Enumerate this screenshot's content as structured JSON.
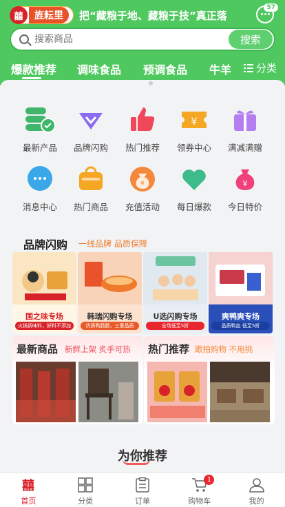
{
  "header": {
    "logo_char": "囍",
    "logo_text": "旌耘里",
    "marquee": "把“藏粮于地、藏粮于技”真正落",
    "message_badge": "57",
    "search_placeholder": "搜索商品",
    "search_button": "搜索",
    "tabs": [
      "爆款推荐",
      "调味食品",
      "预调食品",
      "牛羊"
    ],
    "category_button": "分类"
  },
  "quick_links": [
    {
      "label": "最新产品",
      "icon": "cash-stack-icon",
      "color": "#3fb66b"
    },
    {
      "label": "品牌闪购",
      "icon": "diamond-icon",
      "color": "#8a6cf0"
    },
    {
      "label": "热门推荐",
      "icon": "thumbs-up-icon",
      "color": "#f0485a"
    },
    {
      "label": "领券中心",
      "icon": "coupon-icon",
      "color": "#f5a623"
    },
    {
      "label": "满减满赠",
      "icon": "gift-box-icon",
      "color": "#b57ef0"
    },
    {
      "label": "消息中心",
      "icon": "chat-bubble-icon",
      "color": "#3aa8e8"
    },
    {
      "label": "热门商品",
      "icon": "shopping-bag-icon",
      "color": "#f5a623"
    },
    {
      "label": "充值活动",
      "icon": "money-bag-icon",
      "color": "#f5893b"
    },
    {
      "label": "每日爆款",
      "icon": "heart-icon",
      "color": "#3dbb8a"
    },
    {
      "label": "今日特价",
      "icon": "moneybag-pink-icon",
      "color": "#f0407a"
    }
  ],
  "brand_flash": {
    "title": "品牌闪购",
    "subtitle": "一线品牌 品质保障",
    "cards": [
      {
        "name": "国之味专场",
        "sub": "火锅调味料，好料不添加",
        "name_color": "#d8222a",
        "sub_color": "#d8222a"
      },
      {
        "name": "韩瑞闪购专场",
        "sub": "优质鸭肠肠，三重品质",
        "name_color": "#333333",
        "sub_color": "#e85a2a"
      },
      {
        "name": "U选闪购专场",
        "sub": "全场低至5折",
        "name_color": "#333333",
        "sub_color": "#e8262e"
      },
      {
        "name": "爽鸭爽专场",
        "sub": "品质鸭血 低至5折",
        "name_color": "#ffffff",
        "sub_color": "#1b3fa0"
      }
    ]
  },
  "promos": [
    {
      "title": "最新商品",
      "subtitle": "新鲜上架 炙手可热",
      "subtitle_color": "#f0485a"
    },
    {
      "title": "热门推荐",
      "subtitle": "跟拍购物 不用挑",
      "subtitle_color": "#f5893b"
    }
  ],
  "recommend_title": "为你推荐",
  "tabbar": {
    "items": [
      {
        "label": "首页",
        "icon": "home-logo-icon"
      },
      {
        "label": "分类",
        "icon": "grid-icon"
      },
      {
        "label": "订单",
        "icon": "clipboard-icon"
      },
      {
        "label": "购物车",
        "icon": "cart-icon"
      },
      {
        "label": "我的",
        "icon": "user-icon"
      }
    ],
    "cart_badge": "1"
  }
}
